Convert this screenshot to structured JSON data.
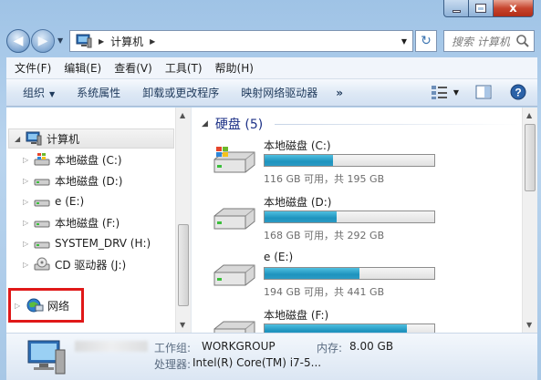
{
  "window": {
    "caption_close": "x"
  },
  "address_bar": {
    "crumb": "计算机",
    "search_placeholder": "搜索 计算机"
  },
  "menu": [
    "文件(F)",
    "编辑(E)",
    "查看(V)",
    "工具(T)",
    "帮助(H)"
  ],
  "toolbar": {
    "organize": "组织",
    "system_properties": "系统属性",
    "uninstall": "卸载或更改程序",
    "map_drive": "映射网络驱动器",
    "more": "»"
  },
  "nav_pane": {
    "root": "计算机",
    "items": [
      {
        "label": "本地磁盘 (C:)",
        "icon": "windows-drive-icon"
      },
      {
        "label": "本地磁盘 (D:)",
        "icon": "drive-icon"
      },
      {
        "label": "e (E:)",
        "icon": "drive-icon"
      },
      {
        "label": "本地磁盘 (F:)",
        "icon": "drive-icon"
      },
      {
        "label": "SYSTEM_DRV (H:)",
        "icon": "drive-icon"
      },
      {
        "label": "CD 驱动器 (J:)",
        "icon": "cd-drive-icon"
      }
    ],
    "network": "网络"
  },
  "content": {
    "group_title": "硬盘 (5)",
    "drives": [
      {
        "name": "本地磁盘 (C:)",
        "info": "116 GB 可用，共 195 GB",
        "used_fraction": 0.405
      },
      {
        "name": "本地磁盘 (D:)",
        "info": "168 GB 可用，共 292 GB",
        "used_fraction": 0.425
      },
      {
        "name": "e (E:)",
        "info": "194 GB 可用，共 441 GB",
        "used_fraction": 0.56
      },
      {
        "name": "本地磁盘 (F:)",
        "info": "",
        "used_fraction": 0.84
      }
    ]
  },
  "details": {
    "workgroup_label": "工作组:",
    "workgroup_value": "WORKGROUP",
    "memory_label": "内存:",
    "memory_value": "8.00 GB",
    "processor_label": "处理器:",
    "processor_value": "Intel(R) Core(TM) i7-5..."
  },
  "colors": {
    "usage_bar": "#1e93be",
    "highlight_box": "#e01818",
    "group_title": "#1e3287"
  }
}
